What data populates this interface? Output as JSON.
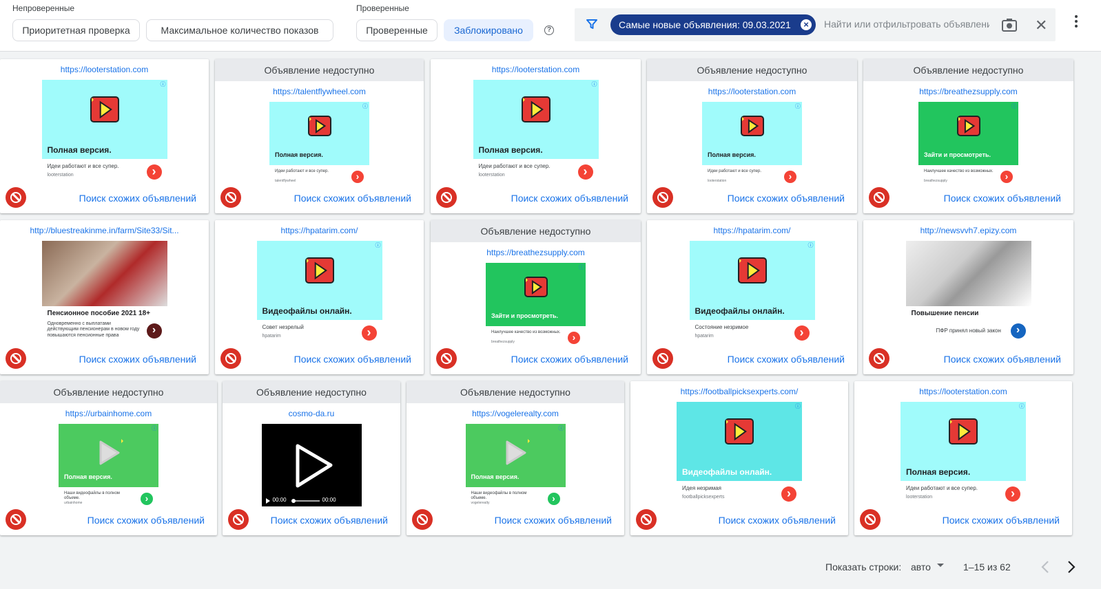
{
  "filters": {
    "unverified_label": "Непроверенные",
    "unverified_chips": [
      "Приоритетная проверка",
      "Максимальное количество показов"
    ],
    "verified_label": "Проверенные",
    "verified_chips": [
      "Проверенные",
      "Заблокировано"
    ],
    "help": "?",
    "active_filter": "Самые новые объявления: 09.03.2021",
    "search_placeholder": "Найти или отфильтровать объявлени"
  },
  "unavailable_text": "Объявление недоступно",
  "similar_text": "Поиск схожих объявлений",
  "cards": [
    {
      "unavailable": false,
      "url": "https://looterstation.com",
      "style": "cyan",
      "title": "Полная версия.",
      "desc": "Идеи работают и все супер.",
      "sub": "looterstation"
    },
    {
      "unavailable": true,
      "url": "https://talentflywheel.com",
      "style": "cyan",
      "title": "Полная версия.",
      "desc": "Идеи работают и все супер.",
      "sub": "talentflywheel"
    },
    {
      "unavailable": false,
      "url": "https://looterstation.com",
      "style": "cyan",
      "title": "Полная версия.",
      "desc": "Идеи работают и все супер.",
      "sub": "looterstation"
    },
    {
      "unavailable": true,
      "url": "https://looterstation.com",
      "style": "cyan",
      "title": "Полная версия.",
      "desc": "Идеи работают и все супер.",
      "sub": "looterstation"
    },
    {
      "unavailable": true,
      "url": "https://breathezsupply.com",
      "style": "green",
      "title": "Зайти и просмотреть.",
      "desc": "Наилучшее качество из возможных.",
      "sub": "breathezsupply"
    },
    {
      "unavailable": false,
      "url": "http://bluestreakinme.in/farm/Site33/Sit...",
      "style": "photo-woman",
      "title": "Пенсионное пособие 2021 18+",
      "desc": "Одновременно с выплатами действующим пенсионерам в новом году повышаются пенсионные права",
      "sub": ""
    },
    {
      "unavailable": false,
      "url": "https://hpatarim.com/",
      "style": "cyan",
      "title": "Видеофайлы онлайн.",
      "desc": "Совет незрелый",
      "sub": "hpatarim"
    },
    {
      "unavailable": true,
      "url": "https://breathezsupply.com",
      "style": "green",
      "title": "Зайти и просмотреть.",
      "desc": "Наилучшее качество из возможных.",
      "sub": "breathezsupply"
    },
    {
      "unavailable": false,
      "url": "https://hpatarim.com/",
      "style": "cyan",
      "title": "Видеофайлы онлайн.",
      "desc": "Состояние незримое",
      "sub": "hpatarim"
    },
    {
      "unavailable": false,
      "url": "http://newsvvh7.epizy.com",
      "style": "photo-calc",
      "title": "Повышение пенсии",
      "desc": "ПФР принял новый закон",
      "sub": ""
    },
    {
      "unavailable": true,
      "url": "https://urbainhome.com",
      "style": "green-grey",
      "title": "Полная версия.",
      "desc": "Наши видеофайлы в полном объеме.",
      "sub": "urbainhome"
    },
    {
      "unavailable": true,
      "url": "cosmo-da.ru",
      "style": "video",
      "title": "",
      "desc": "",
      "sub": "",
      "time": "00:00"
    },
    {
      "unavailable": true,
      "url": "https://vogelerealty.com",
      "style": "green-grey",
      "title": "Полная версия.",
      "desc": "Наши видеофайлы в полном объеме.",
      "sub": "vogelerealty"
    },
    {
      "unavailable": false,
      "url": "https://footballpicksexperts.com/",
      "style": "teal",
      "title": "Видеофайлы онлайн.",
      "desc": "Идея незримая",
      "sub": "footballpicksexperts"
    },
    {
      "unavailable": false,
      "url": "https://looterstation.com",
      "style": "cyan",
      "title": "Полная версия.",
      "desc": "Идеи работают и все супер.",
      "sub": "looterstation"
    }
  ],
  "pagination": {
    "rows_label": "Показать строки:",
    "rows_value": "авто",
    "range": "1–15 из 62"
  },
  "colors": {
    "cyan": "#a0fbfb",
    "green": "#22c55e",
    "teal": "#5ee6e6",
    "link": "#1a73e8",
    "block": "#d93025"
  }
}
